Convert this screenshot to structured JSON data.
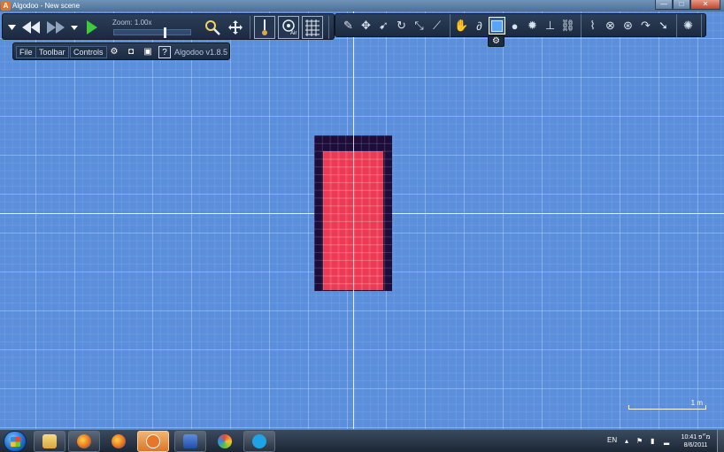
{
  "window": {
    "title": "Algodoo - New scene",
    "app_icon": "A",
    "min_label": "—",
    "max_label": "□",
    "close_label": "✕"
  },
  "toolbar_left": {
    "zoom_label": "Zoom: 1.00x",
    "zoom_level": 1.0,
    "air_label": "Air"
  },
  "menubar": {
    "file": "File",
    "toolbar": "Toolbar",
    "controls": "Controls",
    "version": "Algodoo v1.8.5"
  },
  "tools": [
    "sketch-tool-icon",
    "move-tool-icon",
    "drag-tool-icon",
    "rotate-tool-icon",
    "scale-tool-icon",
    "knife-tool-icon",
    "brush-tool-icon",
    "rope-tool-icon",
    "box-tool-icon",
    "circle-tool-icon",
    "gear-tool-icon",
    "plane-tool-icon",
    "chain-tool-icon",
    "spring-tool-icon",
    "fixate-tool-icon",
    "hinge-tool-icon",
    "tracer-tool-icon",
    "thruster-tool-icon",
    "laser-tool-icon"
  ],
  "scene": {
    "scale_label": "1 m",
    "box_color": "#ec3a54",
    "box_border_color": "#1d0d3a",
    "background_color": "#5b8fdc"
  },
  "taskbar": {
    "language": "EN",
    "time": "10:41 מ״פ",
    "date": "8/6/2011"
  },
  "colors": {
    "toolbar_bg": "#1b2a40",
    "accent": "#5aa4f5"
  }
}
